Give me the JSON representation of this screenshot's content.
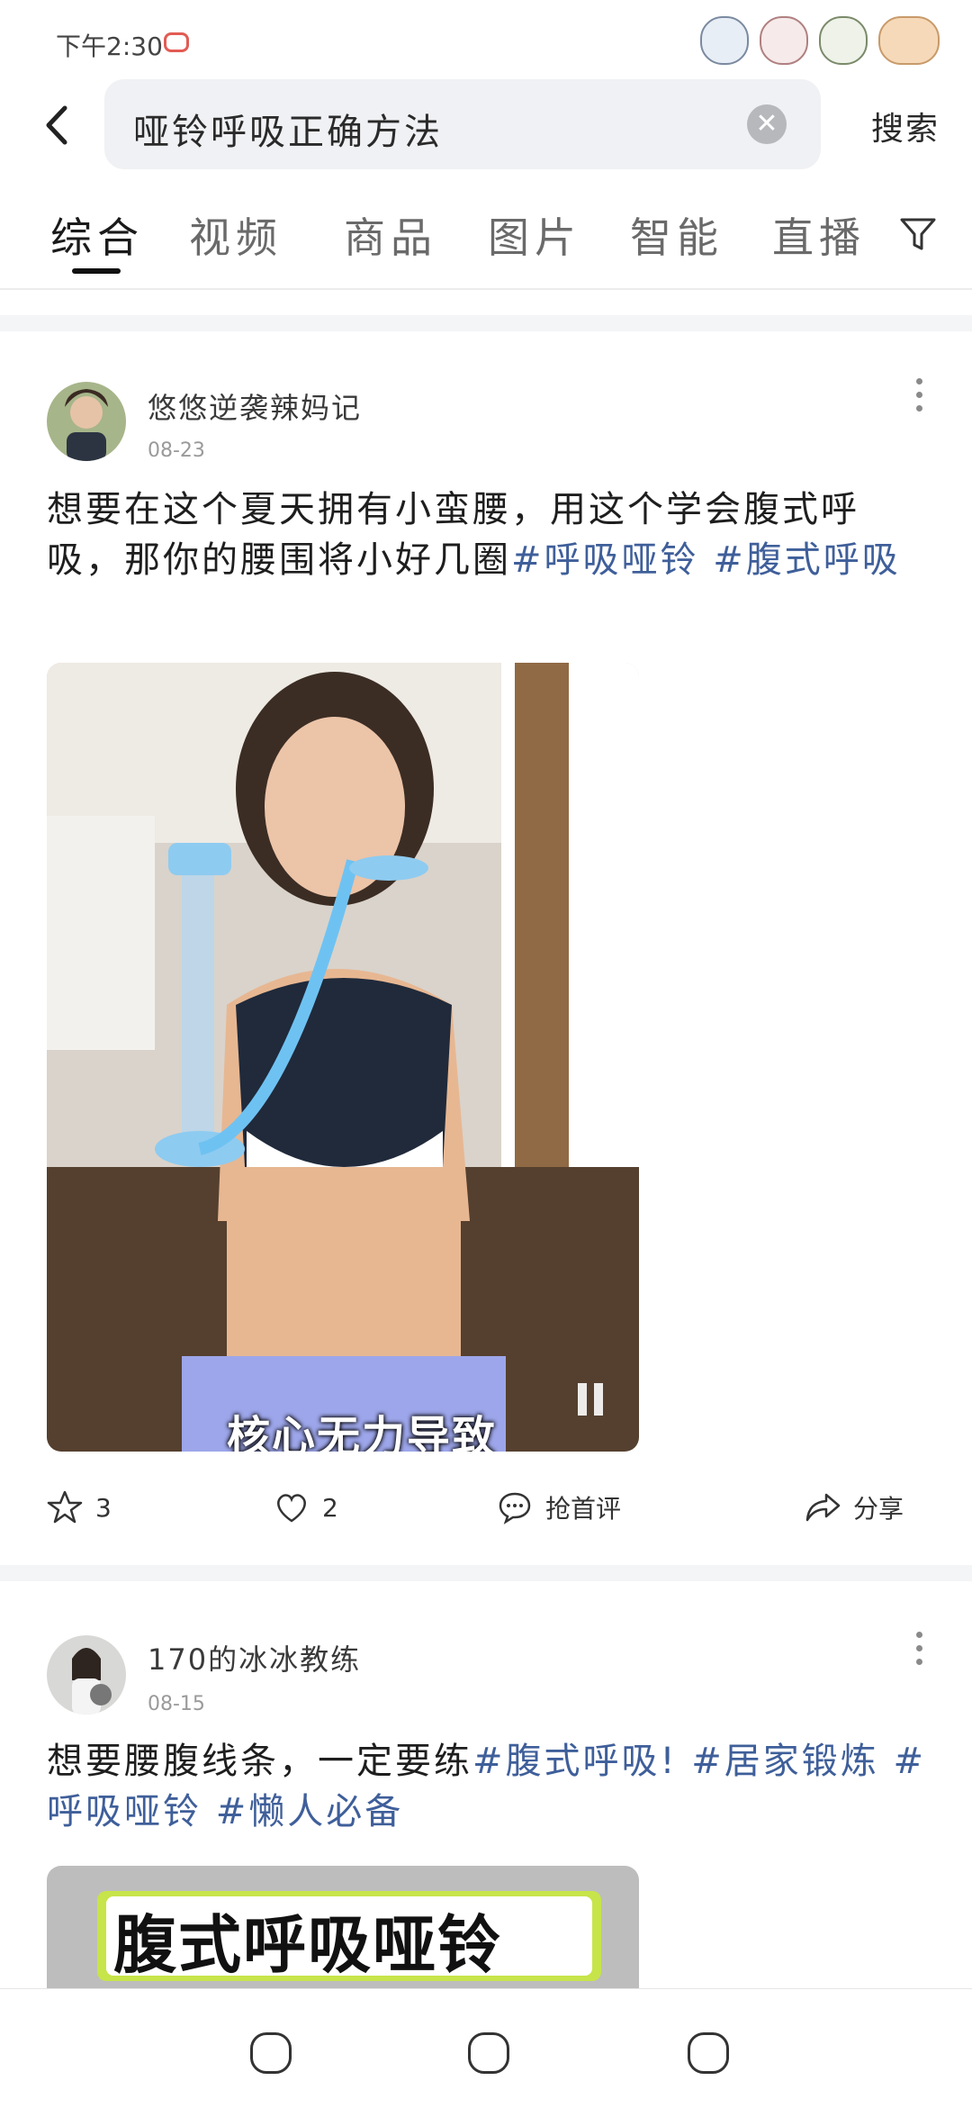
{
  "status": {
    "time": "下午2:30"
  },
  "search": {
    "query": "哑铃呼吸正确方法",
    "button": "搜索"
  },
  "tabs": [
    "综合",
    "视频",
    "商品",
    "图片",
    "智能",
    "直播"
  ],
  "posts": [
    {
      "author": "悠悠逆袭辣妈记",
      "date": "08-23",
      "text_main": "想要在这个夏天拥有小蛮腰，用这个学会腹式呼吸，那你的腰围将小好几圈",
      "tags": "#呼吸哑铃 #腹式呼吸",
      "video_caption": "核心无力导致",
      "favorite_count": "3",
      "like_count": "2",
      "comment_label": "抢首评",
      "share_label": "分享"
    },
    {
      "author": "170的冰冰教练",
      "date": "08-15",
      "text_main": "想要腰腹线条，一定要练",
      "tags": "#腹式呼吸! #居家锻炼 #呼吸哑铃 #懒人必备",
      "image_banner": "腹式呼吸哑铃"
    }
  ],
  "colors": {
    "tag": "#3f5f9a",
    "accent_yellow": "#f2d32a",
    "banner_text": "#111111",
    "clear_btn": "#b6b8bc"
  },
  "icons": [
    "back-arrow-icon",
    "clear-icon",
    "filter-icon",
    "more-icon",
    "star-icon",
    "heart-icon",
    "comment-icon",
    "share-icon",
    "pause-icon"
  ]
}
